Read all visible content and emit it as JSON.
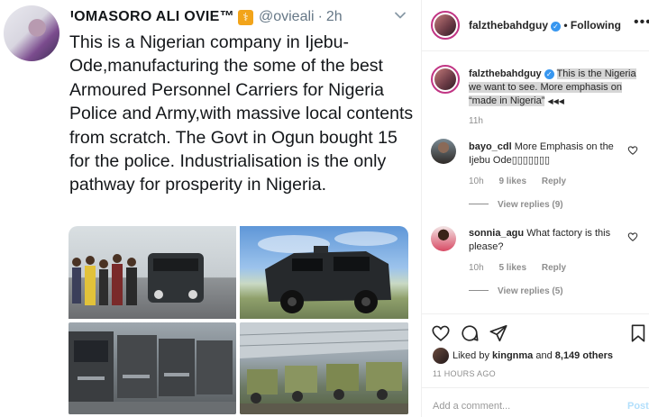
{
  "tweet": {
    "author_name": "ꞋOMASORO ALI OVIE™",
    "badge_icon": "rod-of-asclepius-emoji",
    "handle": "@ovieali",
    "separator": "·",
    "time": "2h",
    "text": "This is a Nigerian company in Ijebu-Ode,manufacturing the some of the best Armoured Personnel Carriers for Nigeria Police and Army,with massive local contents from scratch. The Govt in Ogun bought 15 for the police. Industrialisation is the only pathway for prosperity in Nigeria.",
    "photos": [
      "people-with-armoured-vehicle-indoors",
      "armoured-vehicle-outdoors",
      "row-of-vehicles-under-construction",
      "vehicles-in-workshop-hangar"
    ]
  },
  "instagram": {
    "header": {
      "username": "falzthebahdguy",
      "separator": "•",
      "follow_status": "Following",
      "more_icon": "ellipsis-icon"
    },
    "caption": {
      "username": "falzthebahdguy",
      "text_highlighted": "This is the Nigeria we want to see. More emphasis on “made in Nigeria”",
      "emoji": "◀◀◀",
      "time": "11h"
    },
    "comments": [
      {
        "username": "bayo_cdl",
        "text": "More Emphasis on the Ijebu Ode▯▯▯▯▯▯▯",
        "time": "10h",
        "likes": "9 likes",
        "reply": "Reply",
        "view_replies": "View replies (9)"
      },
      {
        "username": "sonnia_agu",
        "text": "What factory is this please?",
        "time": "10h",
        "likes": "5 likes",
        "reply": "Reply",
        "view_replies": "View replies (5)"
      }
    ],
    "liked_by": {
      "prefix": "Liked by",
      "user": "kingnma",
      "conj": "and",
      "others": "8,149 others"
    },
    "time_ago": "11 HOURS AGO",
    "comment_placeholder": "Add a comment...",
    "post_label": "Post"
  },
  "colors": {
    "accent": "#3897f0",
    "text": "#262626",
    "muted": "#8e8e8e",
    "tweet_gray": "#657786"
  }
}
